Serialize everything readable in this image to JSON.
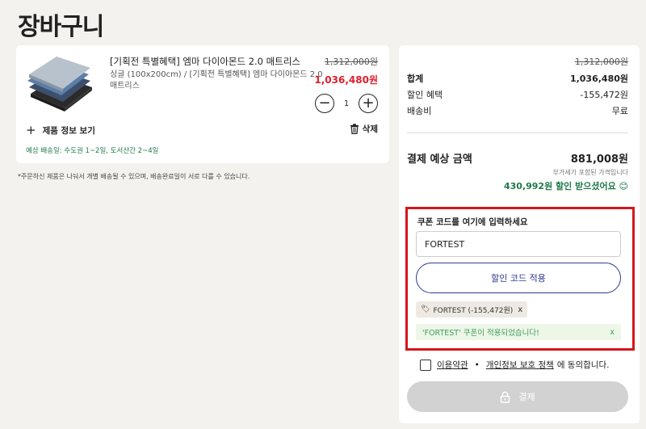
{
  "page": {
    "title": "장바구니"
  },
  "cart": {
    "product": {
      "name": "[기획전 특별혜택] 엠마 다이아몬드 2.0 매트리스",
      "option": "싱글 (100x200cm) / [기획전 특별혜택] 엠마 다이아몬드 2.0 매트리스",
      "orig_price": "1,312,000원",
      "sale_price": "1,036,480원",
      "quantity": "1",
      "minus_symbol": "−",
      "plus_symbol": "+",
      "info_toggle_label": "제품 정보 보기",
      "delete_label": "삭제",
      "shipping_note": "예상 배송일: 수도권 1~2일, 도서산간 2~4일"
    },
    "footnote": "*주문하신 제품은 나눠서 개별 배송될 수 있으며, 배송완료일이 서로 다를 수 있습니다."
  },
  "summary": {
    "orig_total": "1,312,000원",
    "rows": [
      {
        "label": "합계",
        "value": "1,036,480원"
      },
      {
        "label": "할인 혜택",
        "value": "-155,472원"
      },
      {
        "label": "배송비",
        "value": "무료"
      }
    ],
    "pay_label": "결제 예상 금액",
    "pay_amount": "881,008원",
    "tax_note": "부가세가 포함된 가격입니다",
    "saved_note": "430,992원 할인 받으셨어요 😊"
  },
  "coupon": {
    "title": "쿠폰 코드를 여기에 입력하세요",
    "input_value": "FORTEST",
    "apply_label": "할인 코드 적용",
    "tag_label": "FORTEST (-155,472원)",
    "tag_close": "x",
    "success_message": "'FORTEST' 쿠폰이 적용되었습니다!",
    "success_close": "x"
  },
  "agreement": {
    "terms_link": "이용약관",
    "separator": "•",
    "privacy_link": "개인정보 보호 정책",
    "suffix": "에 동의합니다."
  },
  "pay_button": {
    "label": "결제"
  },
  "colors": {
    "background": "#f4f2ee",
    "sale_red": "#e01e2b",
    "green": "#1f7a4a",
    "highlight_border": "#d4161d",
    "apply_blue": "#2f3a8f",
    "pay_disabled": "#d2d2d2"
  }
}
